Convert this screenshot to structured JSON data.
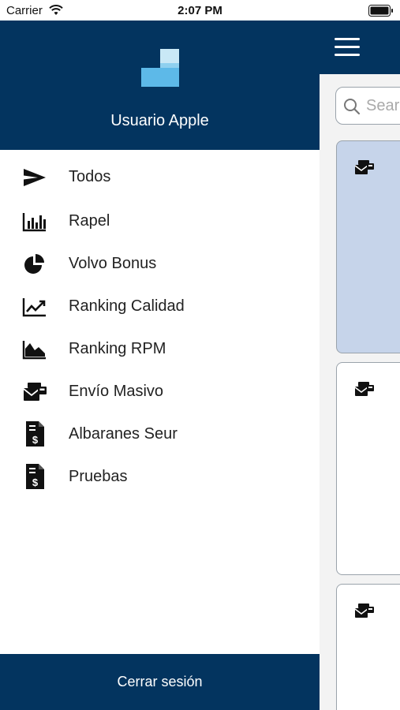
{
  "status_bar": {
    "carrier": "Carrier",
    "time": "2:07 PM"
  },
  "drawer": {
    "user_name": "Usuario Apple",
    "menu_items": [
      {
        "label": "Todos",
        "icon": "send-icon"
      },
      {
        "label": "Rapel",
        "icon": "bar-chart-icon"
      },
      {
        "label": "Volvo Bonus",
        "icon": "pie-chart-icon"
      },
      {
        "label": "Ranking Calidad",
        "icon": "trending-up-icon"
      },
      {
        "label": "Ranking RPM",
        "icon": "area-chart-icon"
      },
      {
        "label": "Envío Masivo",
        "icon": "mass-mail-icon"
      },
      {
        "label": "Albaranes Seur",
        "icon": "invoice-icon"
      },
      {
        "label": "Pruebas",
        "icon": "invoice-icon"
      }
    ],
    "logout_label": "Cerrar sesión"
  },
  "main": {
    "search_placeholder": "Search"
  },
  "colors": {
    "brand": "#03345f",
    "selected_card": "#c6d4ea",
    "logo_light": "#c9e8f6",
    "logo_mid": "#5db9e8"
  }
}
